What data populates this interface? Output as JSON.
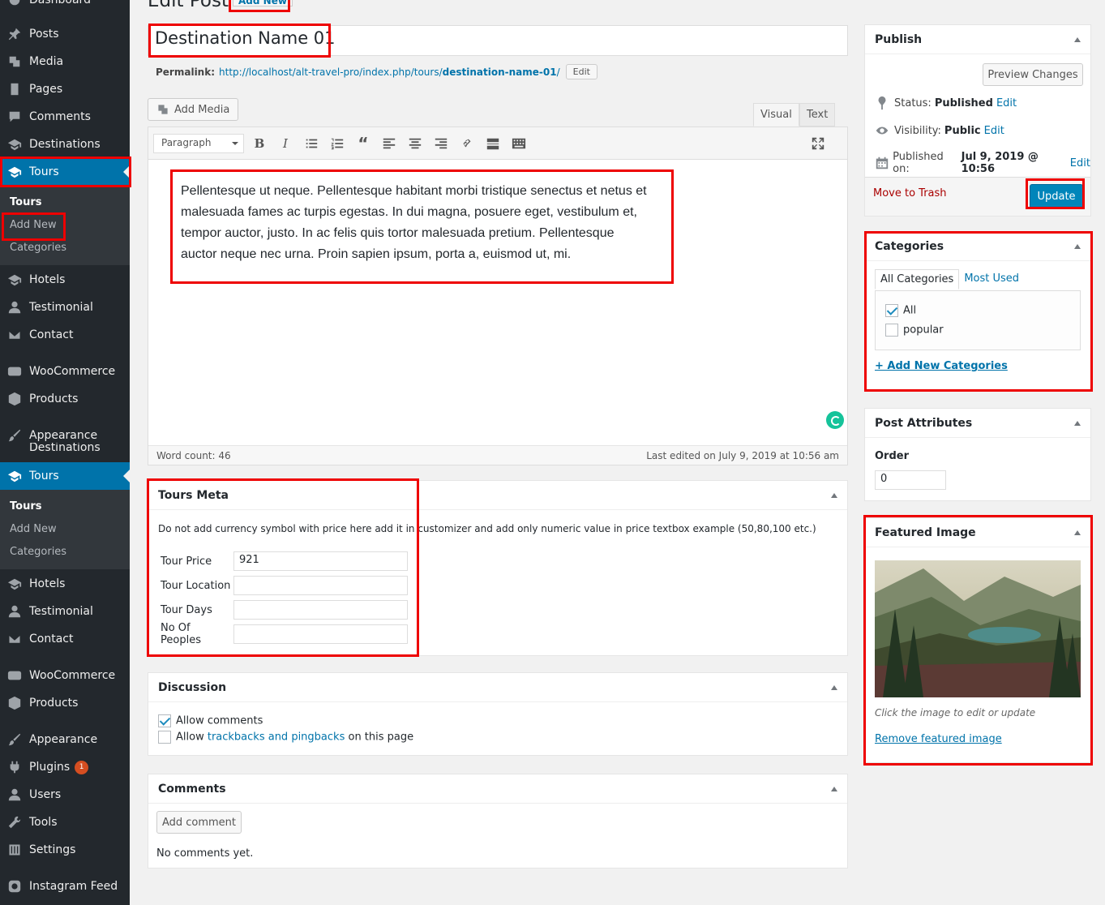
{
  "sidebar": {
    "top_partial": "Dashboard",
    "items": [
      {
        "label": "Posts",
        "icon": "pin-icon"
      },
      {
        "label": "Media",
        "icon": "media-icon"
      },
      {
        "label": "Pages",
        "icon": "pages-icon"
      },
      {
        "label": "Comments",
        "icon": "comments-icon"
      },
      {
        "label": "Destinations",
        "icon": "graduation-cap-icon"
      },
      {
        "label": "Tours",
        "icon": "graduation-cap-icon"
      },
      {
        "label": "Hotels",
        "icon": "graduation-cap-icon"
      },
      {
        "label": "Testimonial",
        "icon": "user-icon"
      },
      {
        "label": "Contact",
        "icon": "mail-icon"
      },
      {
        "label": "WooCommerce",
        "icon": "woo-icon"
      },
      {
        "label": "Products",
        "icon": "box-icon"
      },
      {
        "label": "Appearance",
        "icon": "brush-icon"
      },
      {
        "label": "Destinations",
        "icon": "graduation-cap-icon"
      },
      {
        "label": "Tours",
        "icon": "graduation-cap-icon"
      },
      {
        "label": "Hotels",
        "icon": "graduation-cap-icon"
      },
      {
        "label": "Testimonial",
        "icon": "user-icon"
      },
      {
        "label": "Contact",
        "icon": "mail-icon"
      },
      {
        "label": "WooCommerce",
        "icon": "woo-icon"
      },
      {
        "label": "Products",
        "icon": "box-icon"
      },
      {
        "label": "Appearance",
        "icon": "brush-icon"
      },
      {
        "label": "Plugins",
        "icon": "plugin-icon",
        "badge": "1"
      },
      {
        "label": "Users",
        "icon": "user-icon"
      },
      {
        "label": "Tools",
        "icon": "wrench-icon"
      },
      {
        "label": "Settings",
        "icon": "settings-icon"
      },
      {
        "label": "Instagram Feed",
        "icon": "camera-icon"
      }
    ],
    "submenu_1": [
      "Tours",
      "Add New",
      "Categories"
    ],
    "submenu_2": [
      "Tours",
      "Add New",
      "Categories"
    ]
  },
  "header": {
    "title": "Edit Post",
    "add_new": "Add New"
  },
  "post": {
    "title": "Destination Name 01",
    "permalink_label": "Permalink:",
    "permalink_base": "http://localhost/alt-travel-pro/index.php/tours/",
    "permalink_slug": "destination-name-01",
    "permalink_tail": "/",
    "permalink_edit": "Edit"
  },
  "editor": {
    "add_media": "Add Media",
    "tab_visual": "Visual",
    "tab_text": "Text",
    "format": "Paragraph",
    "content": "Pellentesque ut neque. Pellentesque habitant morbi tristique senectus et netus et malesuada fames ac turpis egestas. In dui magna, posuere eget, vestibulum et, tempor auctor, justo. In ac felis quis tortor malesuada pretium. Pellentesque auctor neque nec urna. Proin sapien ipsum, porta a, euismod ut, mi.",
    "word_count": "Word count: 46",
    "last_edited": "Last edited on July 9, 2019 at 10:56 am"
  },
  "tours_meta": {
    "title": "Tours Meta",
    "note": "Do not add currency symbol with price here add it in customizer and add only numeric value in price textbox example (50,80,100 etc.)",
    "fields": [
      {
        "label": "Tour Price",
        "value": "921"
      },
      {
        "label": "Tour Location",
        "value": ""
      },
      {
        "label": "Tour Days",
        "value": ""
      },
      {
        "label": "No Of Peoples",
        "value": ""
      }
    ]
  },
  "discussion": {
    "title": "Discussion",
    "allow_comments": "Allow comments",
    "allow_prefix": "Allow",
    "trackbacks_link": "trackbacks and pingbacks",
    "allow_suffix": "on this page"
  },
  "comments": {
    "title": "Comments",
    "add_button": "Add comment",
    "empty": "No comments yet."
  },
  "publish": {
    "title": "Publish",
    "preview": "Preview Changes",
    "status_label": "Status:",
    "status_value": "Published",
    "visibility_label": "Visibility:",
    "visibility_value": "Public",
    "published_label": "Published on:",
    "published_value": "Jul 9, 2019 @ 10:56",
    "edit": "Edit",
    "trash": "Move to Trash",
    "update": "Update"
  },
  "categories": {
    "title": "Categories",
    "tab_all": "All Categories",
    "tab_used": "Most Used",
    "items": [
      {
        "label": "All",
        "checked": true
      },
      {
        "label": "popular",
        "checked": false
      }
    ],
    "add_new": "+ Add New Categories"
  },
  "attributes": {
    "title": "Post Attributes",
    "order_label": "Order",
    "order_value": "0"
  },
  "featured": {
    "title": "Featured Image",
    "hint": "Click the image to edit or update",
    "remove": "Remove featured image"
  },
  "colors": {
    "admin_bar": "#23282d",
    "accent": "#0073aa",
    "highlight": "#ee0000"
  }
}
